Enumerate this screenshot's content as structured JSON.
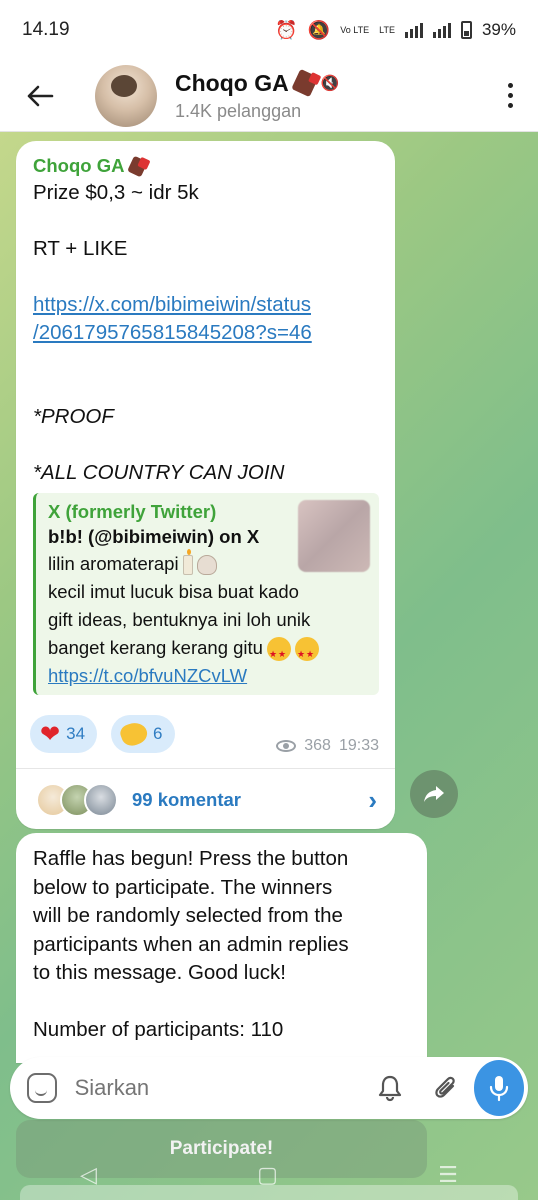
{
  "status": {
    "time": "14.19",
    "battery": "39%",
    "volte": "Vo LTE",
    "lte": "LTE"
  },
  "header": {
    "title": "Choqo GA",
    "subscribers": "1.4K pelanggan"
  },
  "message1": {
    "sender": "Choqo GA",
    "lines": [
      "Prize $0,3 ~ idr 5k",
      "",
      "RT + LIKE",
      "",
      "https://x.com/bibimeiwin/status",
      "/2061795765815845208?s=46",
      "",
      "",
      "*PROOF",
      "",
      "*ALL COUNTRY CAN JOIN"
    ],
    "preview": {
      "site": "X (formerly Twitter)",
      "title": "b!b! (@bibimeiwin) on X",
      "line1": "lilin aromaterapi",
      "line2": "kecil imut lucuk bisa buat kado",
      "line3": "gift ideas, bentuknya ini loh unik",
      "line4": "banget kerang kerang gitu",
      "link": "https://t.co/bfvuNZCvLW"
    },
    "reactions": [
      {
        "emoji": "heart",
        "count": "34"
      },
      {
        "emoji": "clap",
        "count": "6"
      }
    ],
    "views": "368",
    "time": "19:33",
    "comments": "99 komentar"
  },
  "message2": {
    "lines": [
      "Raffle has begun! Press the button",
      "below to participate. The winners",
      "will be randomly selected from the",
      "participants when an admin replies",
      "to this message. Good luck!",
      "",
      "Number of participants: 110"
    ],
    "button": "Participate!"
  },
  "input": {
    "placeholder": "Siarkan"
  },
  "colors": {
    "accent_green": "#3fa33a",
    "link_blue": "#2a7ac0",
    "mic_blue": "#3b94e3"
  }
}
